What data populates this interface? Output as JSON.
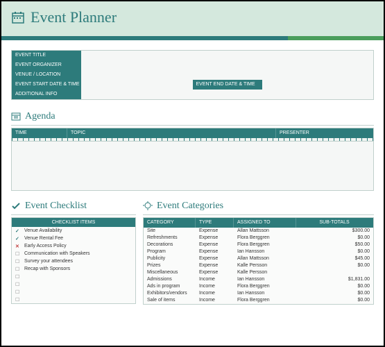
{
  "header": {
    "title": "Event Planner"
  },
  "details": {
    "labels": {
      "title": "EVENT TITLE",
      "organizer": "EVENT ORGANIZER",
      "venue": "VENUE / LOCATION",
      "start": "EVENT START DATE & TIME",
      "end": "EVENT END DATE & TIME",
      "additional": "ADDITIONAL INFO"
    }
  },
  "agenda": {
    "title": "Agenda",
    "columns": {
      "time": "TIME",
      "topic": "TOPIC",
      "presenter": "PRESENTER"
    }
  },
  "checklist": {
    "title": "Event Checklist",
    "header": "CHECKLIST ITEMS",
    "items": [
      {
        "state": "check",
        "label": "Venue Availability"
      },
      {
        "state": "check",
        "label": "Venue Rental Fee"
      },
      {
        "state": "x",
        "label": "Early Access Policy"
      },
      {
        "state": "box",
        "label": "Communication with Speakers"
      },
      {
        "state": "box",
        "label": "Survey your attendees"
      },
      {
        "state": "box",
        "label": "Recap with Sponsors"
      },
      {
        "state": "box",
        "label": ""
      },
      {
        "state": "box",
        "label": ""
      },
      {
        "state": "box",
        "label": ""
      },
      {
        "state": "box",
        "label": ""
      }
    ]
  },
  "categories": {
    "title": "Event Categories",
    "columns": {
      "category": "CATEGORY",
      "type": "TYPE",
      "assigned": "ASSIGNED TO",
      "subtotals": "SUB-TOTALS"
    },
    "rows": [
      {
        "category": "Site",
        "type": "Expense",
        "assigned": "Allan Mattsson",
        "subtotal": "$300.00"
      },
      {
        "category": "Refreshments",
        "type": "Expense",
        "assigned": "Flora Berggren",
        "subtotal": "$0.00"
      },
      {
        "category": "Decorations",
        "type": "Expense",
        "assigned": "Flora Berggren",
        "subtotal": "$50.00"
      },
      {
        "category": "Program",
        "type": "Expense",
        "assigned": "Ian Hansson",
        "subtotal": "$0.00"
      },
      {
        "category": "Publicity",
        "type": "Expense",
        "assigned": "Allan Mattsson",
        "subtotal": "$45.00"
      },
      {
        "category": "Prizes",
        "type": "Expense",
        "assigned": "Kalle Persson",
        "subtotal": "$0.00"
      },
      {
        "category": "Miscellaneous",
        "type": "Expense",
        "assigned": "Kalle Persson",
        "subtotal": ""
      },
      {
        "category": "Admissions",
        "type": "Income",
        "assigned": "Ian Hansson",
        "subtotal": "$1,831.00"
      },
      {
        "category": "Ads in program",
        "type": "Income",
        "assigned": "Flora Berggren",
        "subtotal": "$0.00"
      },
      {
        "category": "Exhibitors/vendors",
        "type": "Income",
        "assigned": "Ian Hansson",
        "subtotal": "$0.00"
      },
      {
        "category": "Sale of items",
        "type": "Income",
        "assigned": "Flora Berggren",
        "subtotal": "$0.00"
      }
    ]
  }
}
